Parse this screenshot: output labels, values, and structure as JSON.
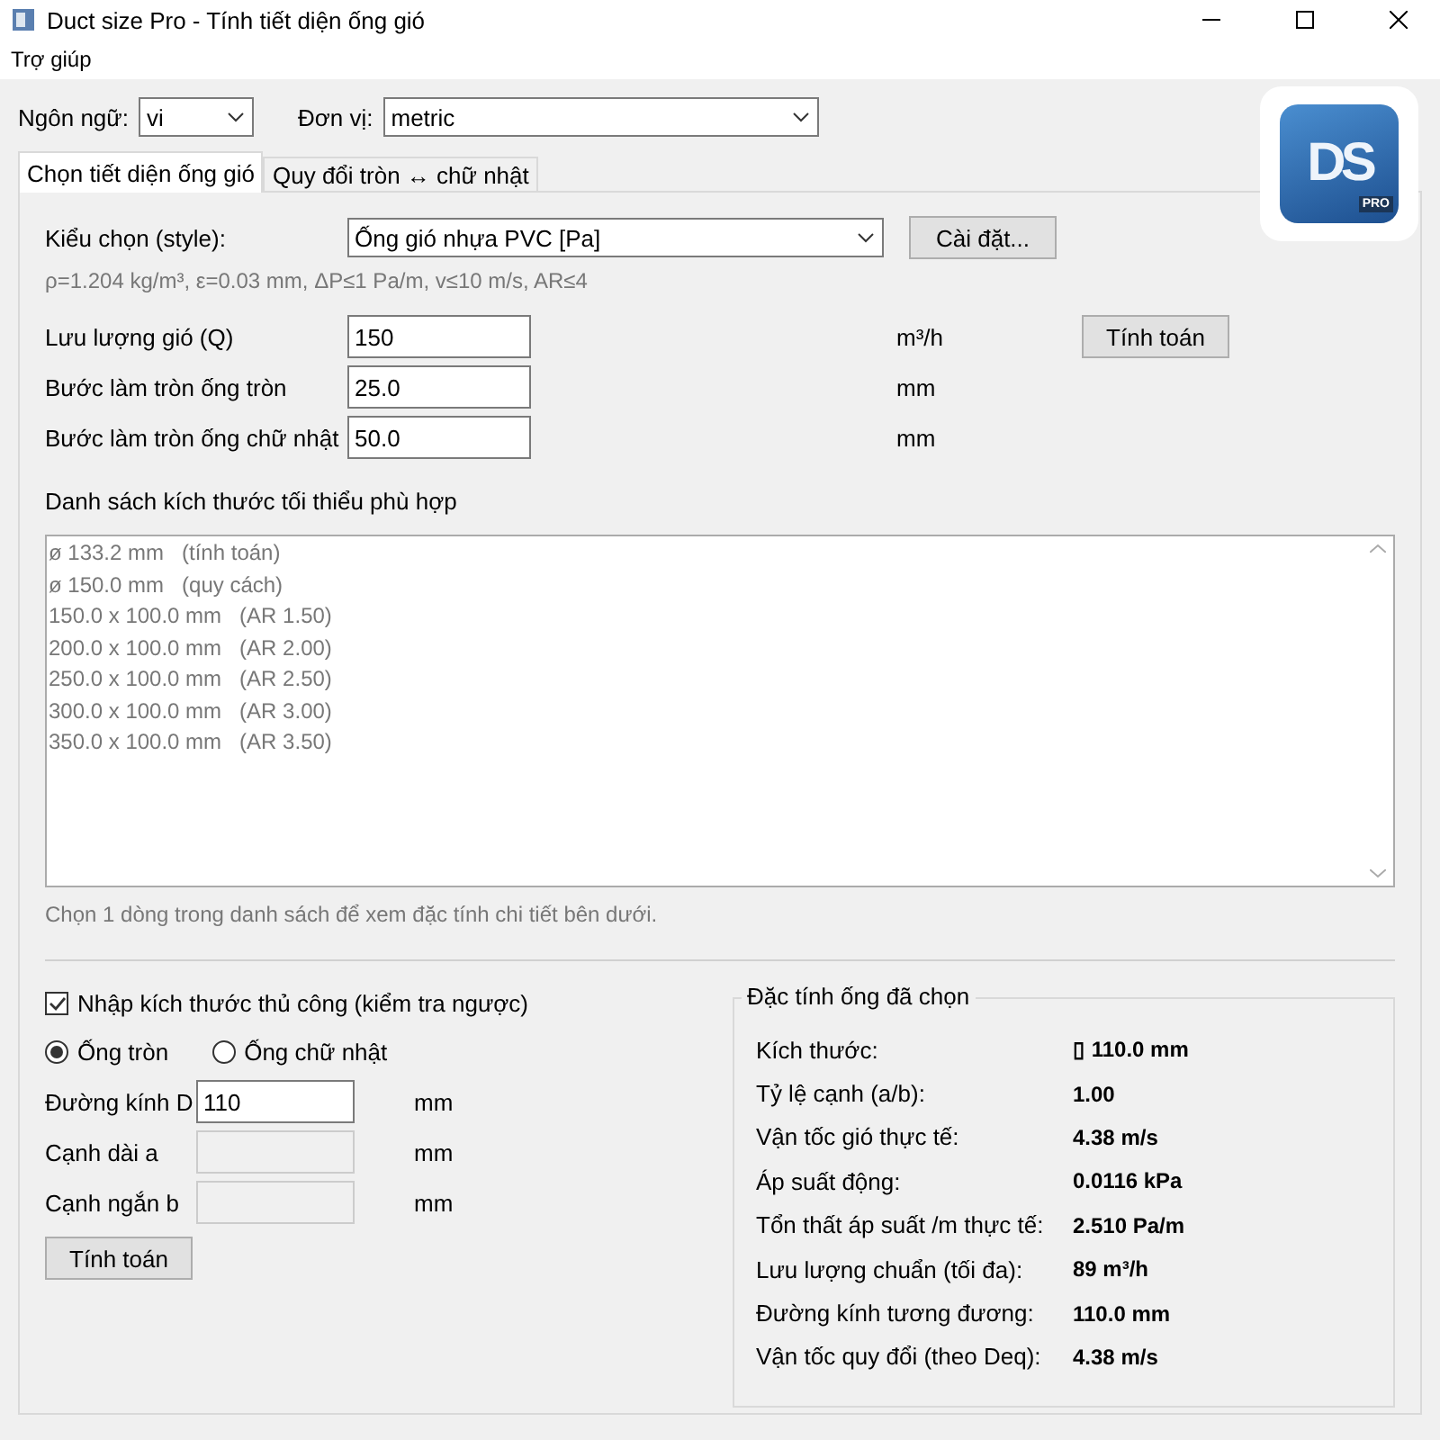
{
  "window": {
    "title": "Duct size Pro - Tính tiết diện ống gió"
  },
  "menu": [
    "Trợ giúp"
  ],
  "language": {
    "label": "Ngôn ngữ:",
    "value": "vi"
  },
  "unit": {
    "label": "Đơn vị:",
    "value": "metric"
  },
  "logo": {
    "letters": "DS",
    "badge": "PRO"
  },
  "tabs": [
    {
      "label": "Chọn tiết diện ống gió",
      "selected": true
    },
    {
      "label": "Quy đổi tròn ↔ chữ nhật",
      "selected": false
    }
  ],
  "style": {
    "label": "Kiểu chọn (style):",
    "value": "Ống gió nhựa PVC [Pa]",
    "button": "Cài đặt..."
  },
  "params": "ρ=1.204 kg/m³, ε=0.03 mm, ΔP≤1 Pa/m, v≤10 m/s, AR≤4",
  "inputs": [
    {
      "label": "Lưu lượng gió (Q)",
      "value": "150",
      "unit": "m³/h"
    },
    {
      "label": "Bước làm tròn ống tròn",
      "value": "25.0",
      "unit": "mm"
    },
    {
      "label": "Bước làm tròn ống chữ nhật",
      "value": "50.0",
      "unit": "mm"
    }
  ],
  "calculate_button": "Tính toán",
  "list": {
    "label": "Danh sách kích thước tối thiểu phù hợp",
    "items": [
      {
        "text": "ø 133.2 mm   (tính toán)",
        "selected": false
      },
      {
        "text": "ø 150.0 mm   (quy cách)",
        "selected": false
      },
      {
        "text": "150.0 x 100.0 mm   (AR 1.50)",
        "selected": false
      },
      {
        "text": "200.0 x 100.0 mm   (AR 2.00)",
        "selected": false
      },
      {
        "text": "250.0 x 100.0 mm   (AR 2.50)",
        "selected": false
      },
      {
        "text": "300.0 x 100.0 mm   (AR 3.00)",
        "selected": false
      },
      {
        "text": "350.0 x 100.0 mm   (AR 3.50)",
        "selected": false
      }
    ]
  },
  "hint": "Chọn 1 dòng trong danh sách để xem đặc tính chi tiết bên dưới.",
  "manual": {
    "checkbox": {
      "label": "Nhập kích thước thủ công (kiểm tra ngược)",
      "checked": true
    },
    "radios": [
      {
        "label": "Ống tròn",
        "selected": true
      },
      {
        "label": "Ống chữ nhật",
        "selected": false
      }
    ],
    "fields": [
      {
        "label": "Đường kính D",
        "value": "110",
        "unit": "mm",
        "disabled": false
      },
      {
        "label": "Cạnh dài a",
        "unit": "mm",
        "disabled": true
      },
      {
        "label": "Cạnh ngắn b",
        "unit": "mm",
        "disabled": true
      }
    ],
    "button": "Tính toán"
  },
  "properties": {
    "title": "Đặc tính ống đã chọn",
    "rows": [
      {
        "label": "Kích thước:",
        "value": "▯ 110.0 mm"
      },
      {
        "label": "Tỷ lệ cạnh (a/b):",
        "value": "1.00"
      },
      {
        "label": "Vận tốc gió thực tế:",
        "value": "4.38 m/s"
      },
      {
        "label": "Áp suất động:",
        "value": "0.0116 kPa"
      },
      {
        "label": "Tổn thất áp suất /m thực tế:",
        "value": "2.510 Pa/m"
      },
      {
        "label": "Lưu lượng chuẩn (tối đa):",
        "value": "89 m³/h"
      },
      {
        "label": "Đường kính tương đương:",
        "value": "110.0 mm"
      },
      {
        "label": "Vận tốc quy đổi (theo Deq):",
        "value": "4.38 m/s"
      }
    ]
  }
}
